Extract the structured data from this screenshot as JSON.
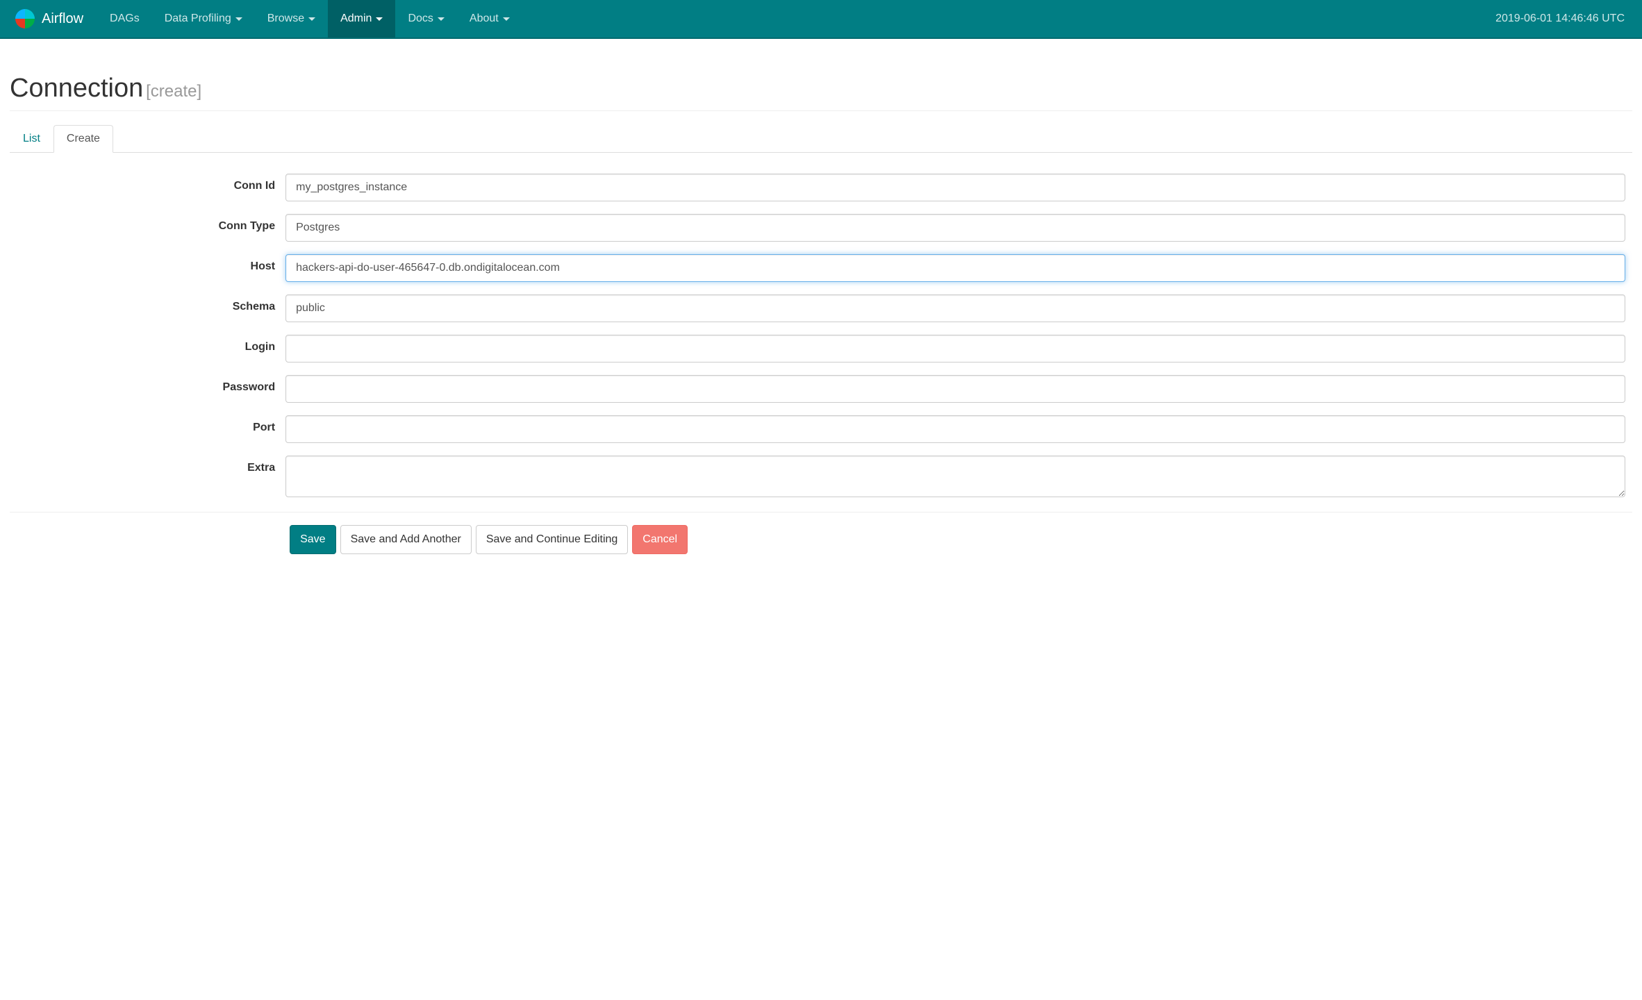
{
  "navbar": {
    "brand": "Airflow",
    "items": [
      {
        "label": "DAGs",
        "dropdown": false,
        "active": false
      },
      {
        "label": "Data Profiling",
        "dropdown": true,
        "active": false
      },
      {
        "label": "Browse",
        "dropdown": true,
        "active": false
      },
      {
        "label": "Admin",
        "dropdown": true,
        "active": true
      },
      {
        "label": "Docs",
        "dropdown": true,
        "active": false
      },
      {
        "label": "About",
        "dropdown": true,
        "active": false
      }
    ],
    "clock": "2019-06-01 14:46:46 UTC"
  },
  "page": {
    "title": "Connection",
    "subtitle": "[create]"
  },
  "tabs": [
    {
      "label": "List",
      "active": false
    },
    {
      "label": "Create",
      "active": true
    }
  ],
  "form": {
    "fields": {
      "conn_id": {
        "label": "Conn Id",
        "value": "my_postgres_instance",
        "type": "text"
      },
      "conn_type": {
        "label": "Conn Type",
        "value": "Postgres",
        "type": "text"
      },
      "host": {
        "label": "Host",
        "value": "hackers-api-do-user-465647-0.db.ondigitalocean.com",
        "type": "text",
        "focused": true
      },
      "schema": {
        "label": "Schema",
        "value": "public",
        "type": "text"
      },
      "login": {
        "label": "Login",
        "value": "",
        "type": "text"
      },
      "password": {
        "label": "Password",
        "value": "",
        "type": "password"
      },
      "port": {
        "label": "Port",
        "value": "",
        "type": "text"
      },
      "extra": {
        "label": "Extra",
        "value": "",
        "type": "textarea"
      }
    },
    "buttons": {
      "save": "Save",
      "save_add": "Save and Add Another",
      "save_continue": "Save and Continue Editing",
      "cancel": "Cancel"
    }
  }
}
